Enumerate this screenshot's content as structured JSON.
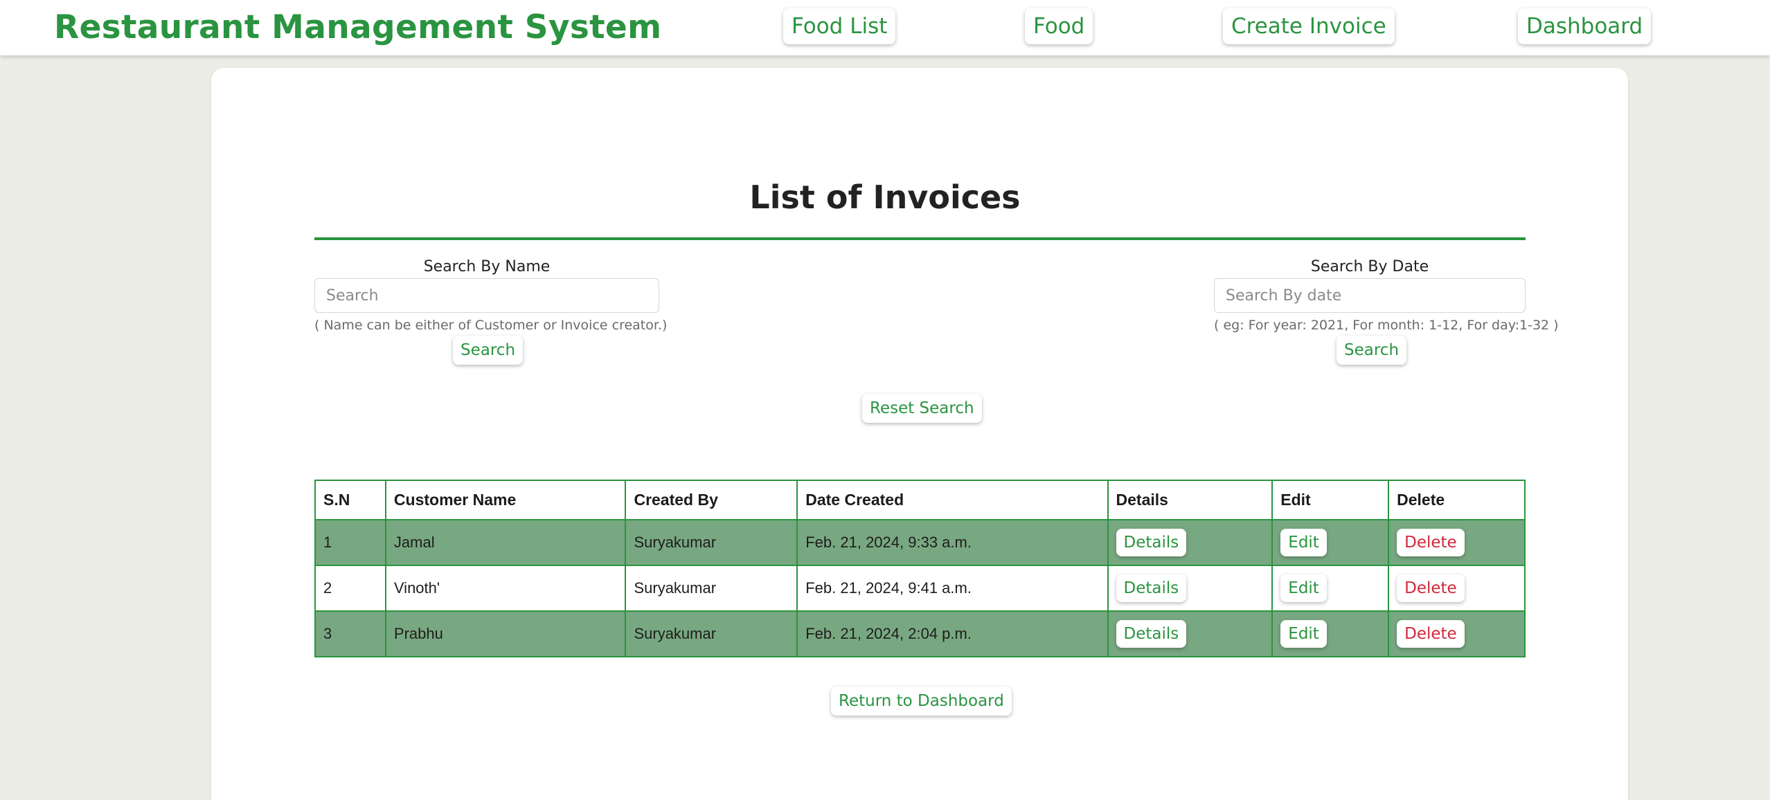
{
  "header": {
    "brand": "Restaurant Management System",
    "nav": [
      "Food List",
      "Food",
      "Create Invoice",
      "Dashboard"
    ]
  },
  "page": {
    "title": "List of Invoices"
  },
  "search_name": {
    "label": "Search By Name",
    "placeholder": "Search",
    "hint": "( Name can be either of Customer or Invoice creator.)",
    "button": "Search"
  },
  "search_date": {
    "label": "Search By Date",
    "placeholder": "Search By date",
    "hint": "( eg: For year: 2021, For month: 1-12, For day:1-32 )",
    "button": "Search"
  },
  "reset_button": "Reset Search",
  "table": {
    "headers": [
      "S.N",
      "Customer Name",
      "Created By",
      "Date Created",
      "Details",
      "Edit",
      "Delete"
    ],
    "rows": [
      {
        "sn": "1",
        "customer": "Jamal",
        "created_by": "Suryakumar",
        "date": "Feb. 21, 2024, 9:33 a.m.",
        "details": "Details",
        "edit": "Edit",
        "delete": "Delete"
      },
      {
        "sn": "2",
        "customer": "Vinoth'",
        "created_by": "Suryakumar",
        "date": "Feb. 21, 2024, 9:41 a.m.",
        "details": "Details",
        "edit": "Edit",
        "delete": "Delete"
      },
      {
        "sn": "3",
        "customer": "Prabhu",
        "created_by": "Suryakumar",
        "date": "Feb. 21, 2024, 2:04 p.m.",
        "details": "Details",
        "edit": "Edit",
        "delete": "Delete"
      }
    ]
  },
  "return_button": "Return to Dashboard",
  "colors": {
    "accent": "#2a9440",
    "danger": "#d0283a",
    "row_shade": "#78a881",
    "page_bg": "#edede8"
  }
}
